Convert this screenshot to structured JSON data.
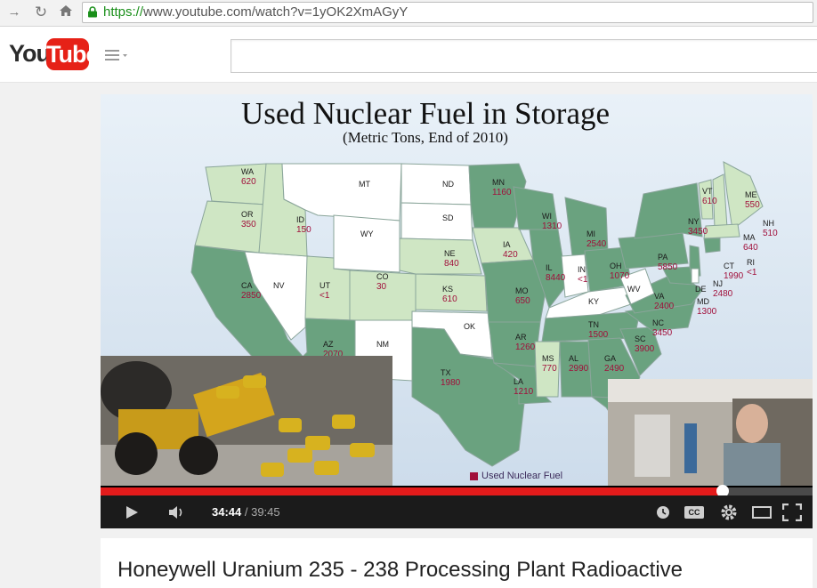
{
  "browser": {
    "url_scheme": "https://",
    "url_rest": "www.youtube.com/watch?v=1yOK2XmAGyY"
  },
  "youtube": {
    "logo_you": "You",
    "logo_tube": "Tube",
    "search_placeholder": ""
  },
  "slide": {
    "title": "Used Nuclear Fuel in Storage",
    "subtitle": "(Metric Tons, End of 2010)",
    "legend": "Used Nuclear Fuel",
    "states": [
      {
        "abbr": "WA",
        "value": "620"
      },
      {
        "abbr": "OR",
        "value": "350"
      },
      {
        "abbr": "CA",
        "value": "2850"
      },
      {
        "abbr": "NV",
        "value": ""
      },
      {
        "abbr": "ID",
        "value": "150"
      },
      {
        "abbr": "MT",
        "value": ""
      },
      {
        "abbr": "WY",
        "value": ""
      },
      {
        "abbr": "UT",
        "value": "<1"
      },
      {
        "abbr": "CO",
        "value": "30"
      },
      {
        "abbr": "AZ",
        "value": "2070"
      },
      {
        "abbr": "NM",
        "value": ""
      },
      {
        "abbr": "ND",
        "value": ""
      },
      {
        "abbr": "SD",
        "value": ""
      },
      {
        "abbr": "NE",
        "value": "840"
      },
      {
        "abbr": "KS",
        "value": "610"
      },
      {
        "abbr": "OK",
        "value": ""
      },
      {
        "abbr": "TX",
        "value": "1980"
      },
      {
        "abbr": "MN",
        "value": "1160"
      },
      {
        "abbr": "IA",
        "value": "420"
      },
      {
        "abbr": "MO",
        "value": "650"
      },
      {
        "abbr": "AR",
        "value": "1260"
      },
      {
        "abbr": "LA",
        "value": "1210"
      },
      {
        "abbr": "WI",
        "value": "1310"
      },
      {
        "abbr": "IL",
        "value": "8440"
      },
      {
        "abbr": "MI",
        "value": "2540"
      },
      {
        "abbr": "IN",
        "value": "<1"
      },
      {
        "abbr": "OH",
        "value": "1070"
      },
      {
        "abbr": "KY",
        "value": ""
      },
      {
        "abbr": "TN",
        "value": "1500"
      },
      {
        "abbr": "MS",
        "value": "770"
      },
      {
        "abbr": "AL",
        "value": "2990"
      },
      {
        "abbr": "GA",
        "value": "2490"
      },
      {
        "abbr": "SC",
        "value": "3900"
      },
      {
        "abbr": "NC",
        "value": "3450"
      },
      {
        "abbr": "VA",
        "value": "2400"
      },
      {
        "abbr": "WV",
        "value": ""
      },
      {
        "abbr": "PA",
        "value": "5850"
      },
      {
        "abbr": "NY",
        "value": "3450"
      },
      {
        "abbr": "VT",
        "value": "610"
      },
      {
        "abbr": "NH",
        "value": "510"
      },
      {
        "abbr": "ME",
        "value": "550"
      },
      {
        "abbr": "MA",
        "value": "640"
      },
      {
        "abbr": "CT",
        "value": "1990"
      },
      {
        "abbr": "RI",
        "value": "<1"
      },
      {
        "abbr": "NJ",
        "value": "2480"
      },
      {
        "abbr": "DE",
        "value": ""
      },
      {
        "abbr": "MD",
        "value": "1300"
      }
    ]
  },
  "player": {
    "current_time": "34:44",
    "separator": " / ",
    "duration": "39:45",
    "progress": 0.874,
    "cc_label": "CC",
    "played_color": "#e31b1b"
  },
  "video": {
    "title": "Honeywell Uranium 235 - 238 Processing Plant Radioactive"
  },
  "colors": {
    "youtube_red": "#e62117",
    "state_dark": "#6aa27f",
    "state_light": "#cfe6c4",
    "state_white": "#ffffff",
    "value_text": "#a1103b"
  }
}
